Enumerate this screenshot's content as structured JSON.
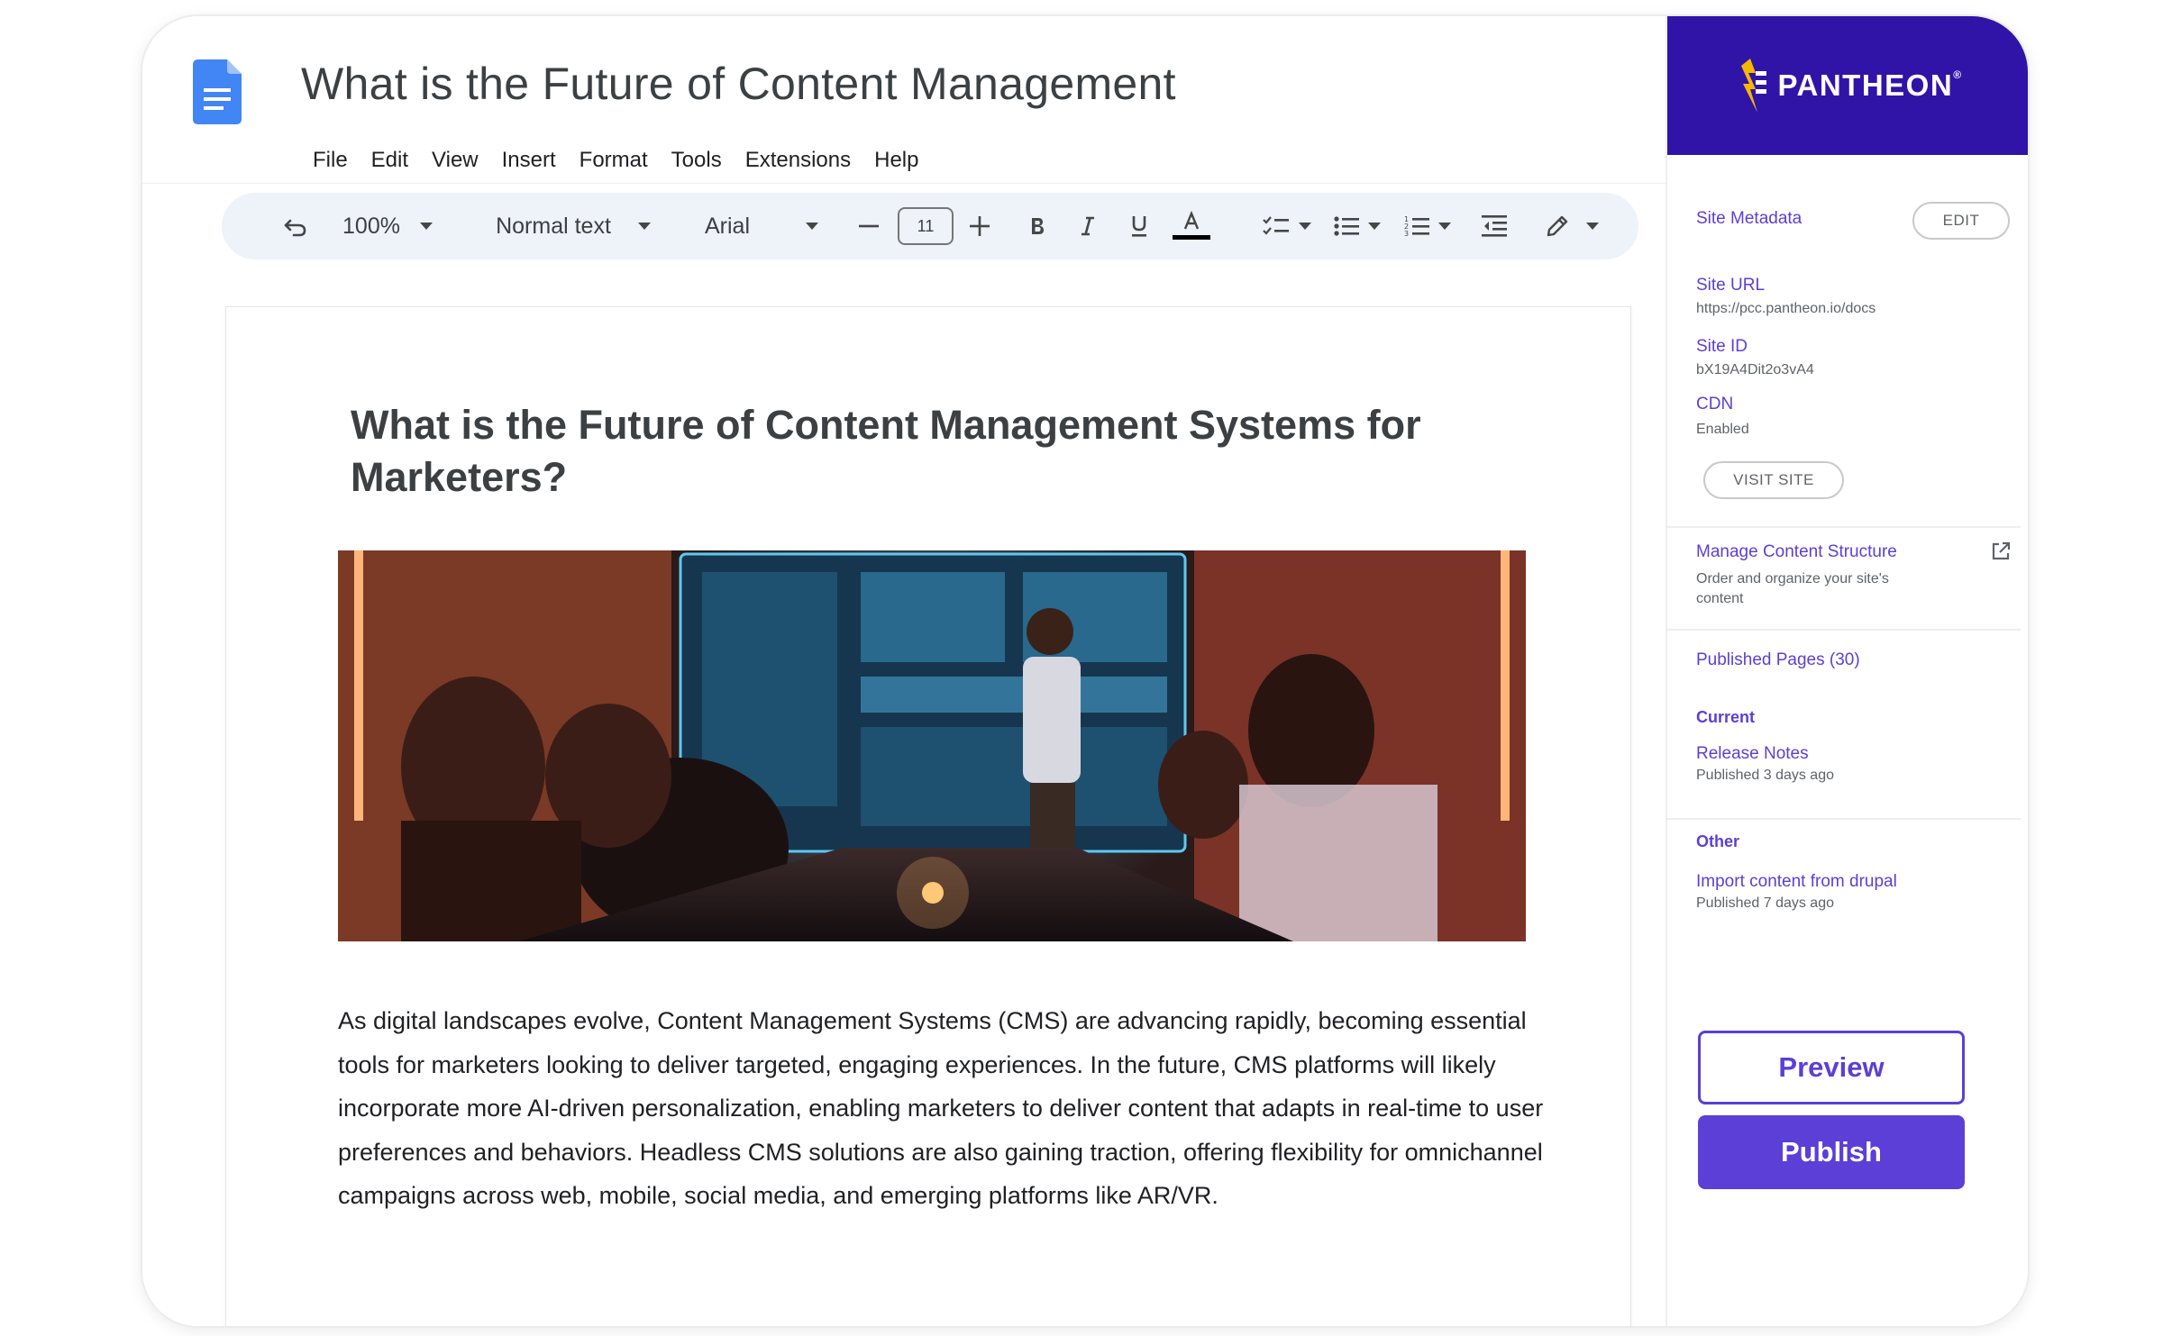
{
  "docs": {
    "title": "What is the Future of Content Management",
    "menu": [
      "File",
      "Edit",
      "View",
      "Insert",
      "Format",
      "Tools",
      "Extensions",
      "Help"
    ],
    "toolbar": {
      "zoom": "100%",
      "style": "Normal text",
      "font": "Arial",
      "font_size": "11"
    },
    "document": {
      "heading": "What is the Future of Content Management Systems for Marketers?",
      "body": "As digital landscapes evolve, Content Management Systems (CMS) are advancing rapidly, becoming essential tools for marketers looking to deliver targeted, engaging experiences. In the future, CMS platforms will likely incorporate more AI-driven personalization, enabling marketers to deliver content that adapts in real-time to user preferences and behaviors. Headless CMS solutions are also gaining traction, offering flexibility for omnichannel campaigns across web, mobile, social media, and emerging platforms like AR/VR."
    }
  },
  "panel": {
    "brand": "PANTHEON",
    "brand_tm": "®",
    "metadata_label": "Site Metadata",
    "edit_label": "EDIT",
    "site_url_label": "Site URL",
    "site_url": "https://pcc.pantheon.io/docs",
    "site_id_label": "Site ID",
    "site_id": "bX19A4Dit2o3vA4",
    "cdn_label": "CDN",
    "cdn_value": "Enabled",
    "visit_site_label": "VISIT SITE",
    "manage_label": "Manage Content Structure",
    "manage_desc_1": "Order and organize your site's",
    "manage_desc_2": "content",
    "published_pages": "Published Pages (30)",
    "current_label": "Current",
    "current_item_title": "Release Notes",
    "current_item_meta": "Published 3 days ago",
    "other_label": "Other",
    "other_item_title": "Import content from drupal",
    "other_item_meta": "Published 7 days ago",
    "preview_label": "Preview",
    "publish_label": "Publish"
  },
  "colors": {
    "pantheon_purple": "#3014a8",
    "accent": "#5b3fd6",
    "docs_blue": "#4285f4",
    "toolbar_bg": "#eef2f9"
  }
}
